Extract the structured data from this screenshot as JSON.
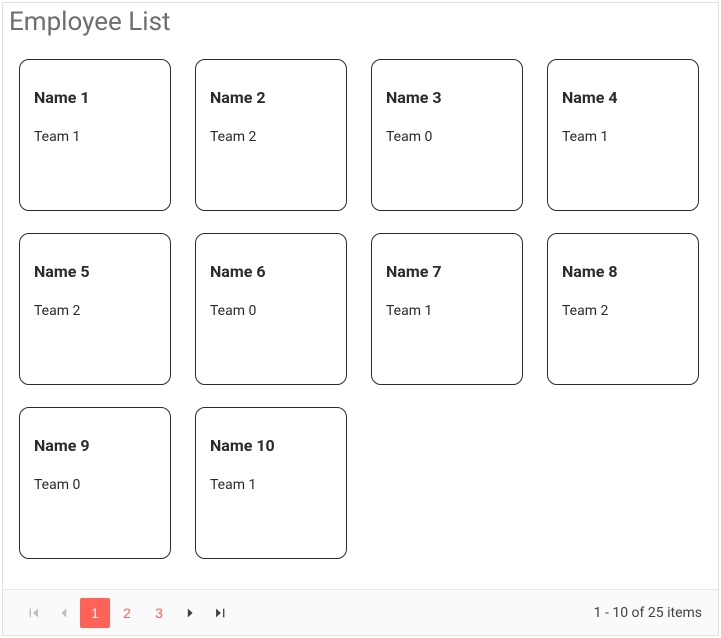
{
  "title": "Employee List",
  "employees": [
    {
      "name": "Name 1",
      "team": "Team 1"
    },
    {
      "name": "Name 2",
      "team": "Team 2"
    },
    {
      "name": "Name 3",
      "team": "Team 0"
    },
    {
      "name": "Name 4",
      "team": "Team 1"
    },
    {
      "name": "Name 5",
      "team": "Team 2"
    },
    {
      "name": "Name 6",
      "team": "Team 0"
    },
    {
      "name": "Name 7",
      "team": "Team 1"
    },
    {
      "name": "Name 8",
      "team": "Team 2"
    },
    {
      "name": "Name 9",
      "team": "Team 0"
    },
    {
      "name": "Name 10",
      "team": "Team 1"
    }
  ],
  "pager": {
    "pages": [
      "1",
      "2",
      "3"
    ],
    "active_index": 0,
    "info": "1 - 10 of 25 items"
  }
}
